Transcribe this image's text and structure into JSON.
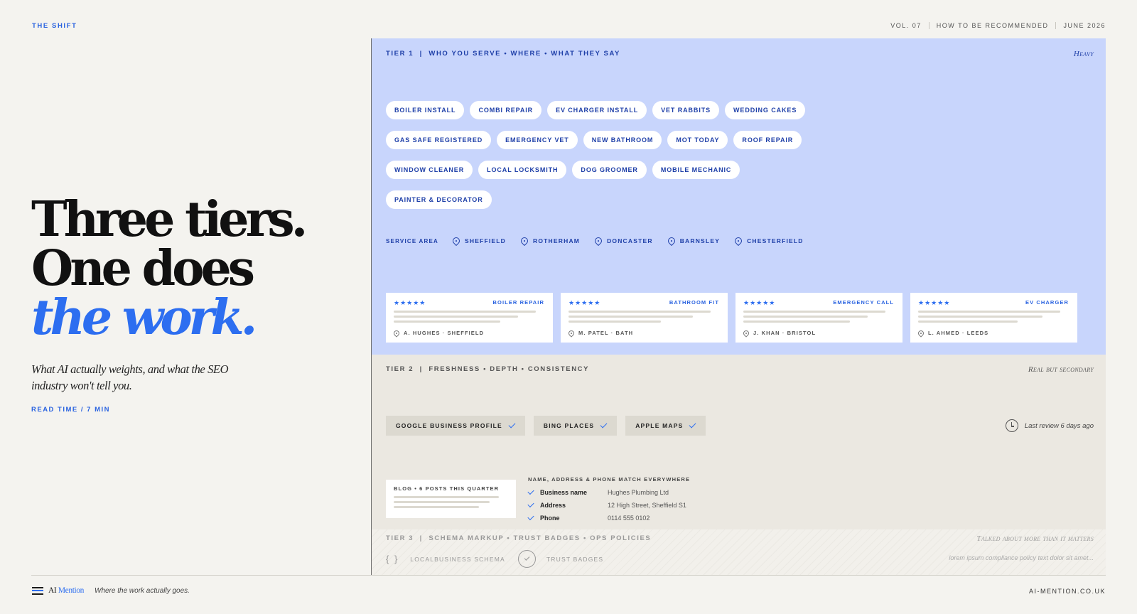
{
  "header": {
    "brand": "THE SHIFT",
    "volume": "VOL. 07",
    "issue_title": "HOW TO BE RECOMMENDED",
    "date": "JUNE 2026"
  },
  "hero": {
    "title_line1": "Three tiers.",
    "title_line2": "One does",
    "title_line3": "the work.",
    "subtitle": "What AI actually weights, and what the SEO industry won't tell you.",
    "read_time": "READ TIME / 7 MIN"
  },
  "tier1": {
    "heading": "TIER 1  |  WHO YOU SERVE • WHERE • WHAT THEY SAY",
    "tag": "Heavy",
    "services": [
      "BOILER INSTALL",
      "COMBI REPAIR",
      "EV CHARGER INSTALL",
      "VET RABBITS",
      "WEDDING CAKES",
      "GAS SAFE REGISTERED",
      "EMERGENCY VET",
      "NEW BATHROOM",
      "MOT TODAY",
      "ROOF REPAIR",
      "WINDOW CLEANER",
      "LOCAL LOCKSMITH",
      "DOG GROOMER",
      "MOBILE MECHANIC",
      "PAINTER & DECORATOR"
    ],
    "service_area_label": "SERVICE AREA",
    "locations": [
      "SHEFFIELD",
      "ROTHERHAM",
      "DONCASTER",
      "BARNSLEY",
      "CHESTERFIELD"
    ],
    "reviews": [
      {
        "stars": "★★★★★",
        "category": "BOILER REPAIR",
        "author": "A. HUGHES · SHEFFIELD"
      },
      {
        "stars": "★★★★★",
        "category": "BATHROOM FIT",
        "author": "M. PATEL · BATH"
      },
      {
        "stars": "★★★★★",
        "category": "EMERGENCY CALL",
        "author": "J. KHAN · BRISTOL"
      },
      {
        "stars": "★★★★★",
        "category": "EV CHARGER",
        "author": "L. AHMED · LEEDS"
      }
    ]
  },
  "tier2": {
    "heading": "TIER 2  |  FRESHNESS • DEPTH • CONSISTENCY",
    "tag": "Real but secondary",
    "platforms": [
      "GOOGLE BUSINESS PROFILE",
      "BING PLACES",
      "APPLE MAPS"
    ],
    "last_review": "Last review 6 days ago",
    "blog_label": "BLOG • 6 POSTS THIS QUARTER",
    "nap_title": "NAME, ADDRESS & PHONE MATCH EVERYWHERE",
    "nap": [
      {
        "key": "Business name",
        "value": "Hughes Plumbing Ltd"
      },
      {
        "key": "Address",
        "value": "12 High Street, Sheffield S1"
      },
      {
        "key": "Phone",
        "value": "0114 555 0102"
      }
    ]
  },
  "tier3": {
    "heading": "TIER 3  |  SCHEMA MARKUP • TRUST BADGES • OPS POLICIES",
    "tag": "Talked about more than it matters",
    "braces": "{ }",
    "schema_label": "LOCALBUSINESS SCHEMA",
    "badges_label": "TRUST BADGES",
    "note": "lorem ipsum compliance policy text dolor sit amet..."
  },
  "footer": {
    "logo_ai": "AI",
    "logo_mention": "Mention",
    "tagline": "Where the work actually goes.",
    "url": "AI-MENTION.CO.UK"
  },
  "colors": {
    "accent": "#2d6ef0",
    "tier1_bg": "#c8d5fc",
    "tier2_bg": "#ebe8e1",
    "page_bg": "#f4f3ef"
  }
}
